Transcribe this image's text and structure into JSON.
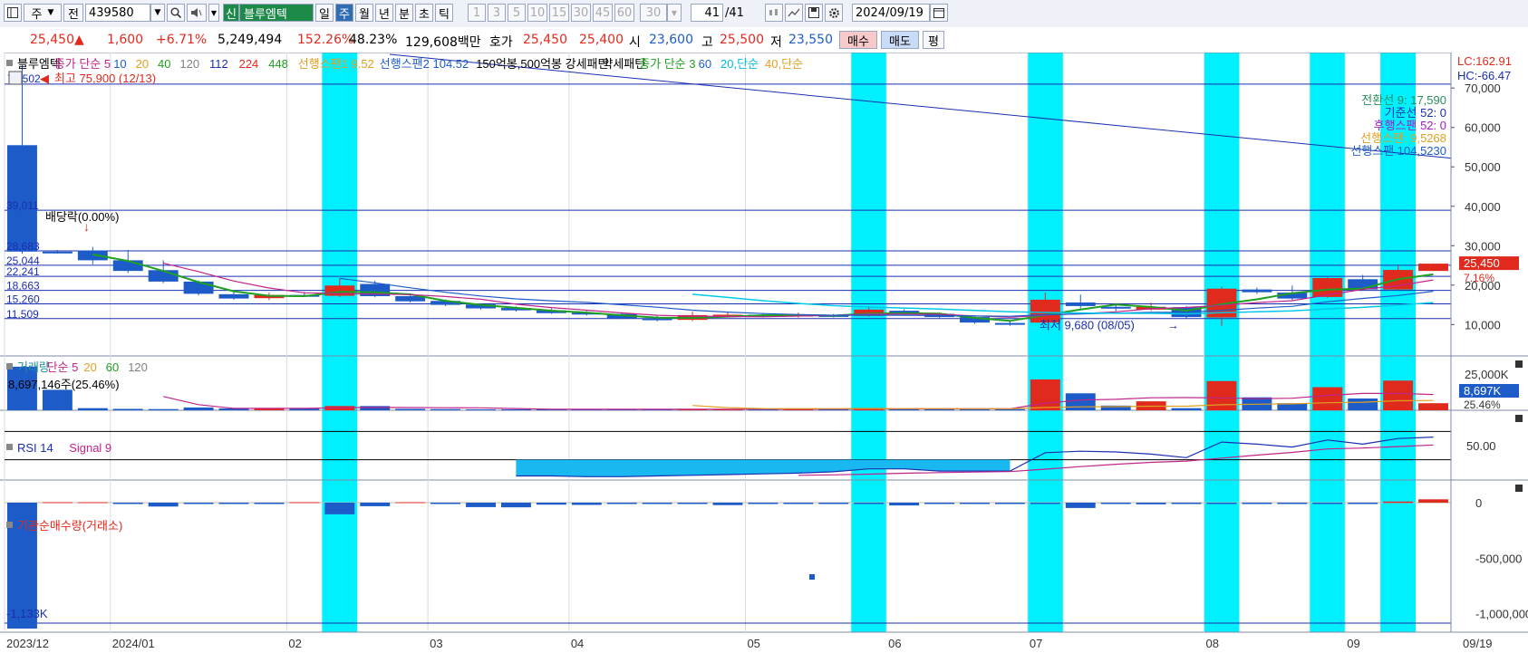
{
  "toolbar": {
    "view_icon": "layout-icon",
    "market_select": "주",
    "prev_label": "전",
    "code": "439580",
    "badge": "신",
    "name": "블루엠텍",
    "period_tabs": [
      "일",
      "주",
      "월",
      "년",
      "분",
      "초",
      "틱"
    ],
    "active_period": "주",
    "intervals": [
      "1",
      "3",
      "5",
      "10",
      "15",
      "30",
      "45",
      "60"
    ],
    "interval_select": "30",
    "count_value": "41",
    "count_total": "/41",
    "date": "2024/09/19"
  },
  "quote": {
    "price": "25,450",
    "change_sign": "▲",
    "change": "1,600",
    "change_pct": "+6.71%",
    "volume": "5,249,494",
    "volume_ratio": "152.26%",
    "turnover_ratio": "48.23%",
    "amount": "129,608백만",
    "hoga_label": "호가",
    "ask": "25,450",
    "bid": "25,400",
    "open_label": "시",
    "open": "23,600",
    "high_label": "고",
    "high": "25,500",
    "low_label": "저",
    "low": "23,550",
    "buy_button": "매수",
    "sell_button": "매도",
    "eval_button": "평"
  },
  "colors": {
    "up": "#e02a1e",
    "down": "#1d5cc8",
    "highlight": "#00f0ff",
    "grid_line": "#1a2fb0",
    "ma5": "#c0248a",
    "ma10": "#1d5cc8",
    "ma20": "#e0a020",
    "ma40": "#20a020"
  },
  "price_pane": {
    "legend": [
      {
        "text": "블루엠텍",
        "color": "#000000"
      },
      {
        "text": "종가 단순 5",
        "color": "#c0248a"
      },
      {
        "text": "10",
        "color": "#1d5cc8"
      },
      {
        "text": "20",
        "color": "#e0a020"
      },
      {
        "text": "40",
        "color": "#20a020"
      },
      {
        "text": "120",
        "color": "#808080"
      },
      {
        "text": "112",
        "color": "#1a2fb0"
      },
      {
        "text": "224",
        "color": "#e02a1e"
      },
      {
        "text": "448",
        "color": "#20a020"
      },
      {
        "text": "선행스팬1 9.52",
        "color": "#e0a020"
      },
      {
        "text": "선행스팬2 104.52",
        "color": "#1d5cc8"
      },
      {
        "text": "150억봉,500억봉 강세패턴",
        "color": "#000000"
      },
      {
        "text": "약세패턴",
        "color": "#000000"
      },
      {
        "text": "종가 단순 3",
        "color": "#20a020"
      },
      {
        "text": "60",
        "color": "#1d5cc8"
      },
      {
        "text": "20,단순",
        "color": "#00c0e0"
      },
      {
        "text": "40,단순",
        "color": "#e0a020"
      }
    ],
    "high_note": "최고 75,900 (12/13)",
    "low_note": "최저 9,680 (08/05)",
    "dividend_note": "배당락(0.00%)",
    "top_left_value": "74,502",
    "level_labels": [
      "39,011",
      "28,683",
      "25,044",
      "22,241",
      "18,663",
      "15,260",
      "11,509"
    ],
    "right_top": [
      "LC:162.91",
      "HC:-66.47"
    ],
    "ichimoku_labels": [
      {
        "text": "전환선 9: 17,590",
        "color": "#2a8f5a"
      },
      {
        "text": "기준선 52: 0",
        "color": "#1a2fb0"
      },
      {
        "text": "후행스팬 52: 0",
        "color": "#a020c0"
      },
      {
        "text": "선행스팬: 9,5268",
        "color": "#e0a020"
      },
      {
        "text": "선행스팬 104,5230",
        "color": "#1d5cc8"
      }
    ],
    "axis": [
      "70,000",
      "60,000",
      "50,000",
      "40,000",
      "30,000",
      "20,000",
      "10,000"
    ],
    "current_price": "25,450",
    "current_pct": "7.16%"
  },
  "volume_pane": {
    "legend": [
      {
        "text": "거래량",
        "color": "#1d8a9a"
      },
      {
        "text": "단순 5",
        "color": "#c0248a"
      },
      {
        "text": "20",
        "color": "#e0a020"
      },
      {
        "text": "60",
        "color": "#20a020"
      },
      {
        "text": "120",
        "color": "#808080"
      }
    ],
    "last_value": "8,697,146주(25.46%)",
    "axis": [
      "25,000K"
    ],
    "current_value": "8,697K",
    "current_pct": "25.46%"
  },
  "rsi_pane": {
    "legend": [
      {
        "text": "RSI 14",
        "color": "#1a2fb0"
      },
      {
        "text": "Signal 9",
        "color": "#c0248a"
      }
    ],
    "axis": [
      "50.00"
    ]
  },
  "inst_pane": {
    "legend": [
      {
        "text": "기관순매수량(거래소)",
        "color": "#e02a1e"
      }
    ],
    "min_label": "-1,133K",
    "axis": [
      "0",
      "-500,000",
      "-1,000,000"
    ]
  },
  "x_axis": [
    "2023/12",
    "2024/01",
    "02",
    "03",
    "04",
    "05",
    "06",
    "07",
    "08",
    "09",
    "09/19"
  ],
  "candles": [
    {
      "o": 55500,
      "c": 28500,
      "h": 75900,
      "l": 28000,
      "up": false
    },
    {
      "o": 28500,
      "c": 28500,
      "h": 28900,
      "l": 28000,
      "up": false
    },
    {
      "o": 28800,
      "c": 26300,
      "h": 29700,
      "l": 25300,
      "up": false
    },
    {
      "o": 26300,
      "c": 23600,
      "h": 28900,
      "l": 23100,
      "up": false
    },
    {
      "o": 23800,
      "c": 20900,
      "h": 26300,
      "l": 20500,
      "up": false
    },
    {
      "o": 20900,
      "c": 17800,
      "h": 21200,
      "l": 17400,
      "up": false
    },
    {
      "o": 17700,
      "c": 16600,
      "h": 18500,
      "l": 16300,
      "up": false
    },
    {
      "o": 16700,
      "c": 17500,
      "h": 18100,
      "l": 16200,
      "up": true
    },
    {
      "o": 17500,
      "c": 17500,
      "h": 18300,
      "l": 17100,
      "up": false
    },
    {
      "o": 17300,
      "c": 19900,
      "h": 21700,
      "l": 17000,
      "up": true
    },
    {
      "o": 20300,
      "c": 17200,
      "h": 21100,
      "l": 16900,
      "up": false
    },
    {
      "o": 17200,
      "c": 15900,
      "h": 17700,
      "l": 15600,
      "up": false
    },
    {
      "o": 16000,
      "c": 15000,
      "h": 16400,
      "l": 14700,
      "up": false
    },
    {
      "o": 15100,
      "c": 14100,
      "h": 15400,
      "l": 13800,
      "up": false
    },
    {
      "o": 14200,
      "c": 13600,
      "h": 14600,
      "l": 13300,
      "up": false
    },
    {
      "o": 13600,
      "c": 12900,
      "h": 14100,
      "l": 12700,
      "up": false
    },
    {
      "o": 13000,
      "c": 12600,
      "h": 13400,
      "l": 12300,
      "up": false
    },
    {
      "o": 12700,
      "c": 11600,
      "h": 13100,
      "l": 11400,
      "up": false
    },
    {
      "o": 11600,
      "c": 11100,
      "h": 12200,
      "l": 10800,
      "up": false
    },
    {
      "o": 11200,
      "c": 12400,
      "h": 13300,
      "l": 10900,
      "up": true
    },
    {
      "o": 12400,
      "c": 12500,
      "h": 13200,
      "l": 12000,
      "up": true
    },
    {
      "o": 12500,
      "c": 12200,
      "h": 12900,
      "l": 11900,
      "up": false
    },
    {
      "o": 12200,
      "c": 12500,
      "h": 13000,
      "l": 11800,
      "up": true
    },
    {
      "o": 12400,
      "c": 12100,
      "h": 12700,
      "l": 11800,
      "up": false
    },
    {
      "o": 12200,
      "c": 13800,
      "h": 14600,
      "l": 12000,
      "up": true
    },
    {
      "o": 13500,
      "c": 12700,
      "h": 13900,
      "l": 12400,
      "up": false
    },
    {
      "o": 12700,
      "c": 11900,
      "h": 13000,
      "l": 11700,
      "up": false
    },
    {
      "o": 11900,
      "c": 10500,
      "h": 12100,
      "l": 10200,
      "up": false
    },
    {
      "o": 10400,
      "c": 10400,
      "h": 10900,
      "l": 9700,
      "up": false
    },
    {
      "o": 10500,
      "c": 16300,
      "h": 18100,
      "l": 10400,
      "up": true
    },
    {
      "o": 15600,
      "c": 14700,
      "h": 17600,
      "l": 14100,
      "up": false
    },
    {
      "o": 14500,
      "c": 14200,
      "h": 15100,
      "l": 13400,
      "up": false
    },
    {
      "o": 13800,
      "c": 14500,
      "h": 15600,
      "l": 13500,
      "up": true
    },
    {
      "o": 14400,
      "c": 11900,
      "h": 14700,
      "l": 11600,
      "up": false
    },
    {
      "o": 11800,
      "c": 19100,
      "h": 19600,
      "l": 9680,
      "up": true
    },
    {
      "o": 18900,
      "c": 18200,
      "h": 19400,
      "l": 17800,
      "up": false
    },
    {
      "o": 18100,
      "c": 16600,
      "h": 19900,
      "l": 16200,
      "up": false
    },
    {
      "o": 17000,
      "c": 21800,
      "h": 22000,
      "l": 16800,
      "up": true
    },
    {
      "o": 21500,
      "c": 18900,
      "h": 22600,
      "l": 18600,
      "up": false
    },
    {
      "o": 18900,
      "c": 23850,
      "h": 25000,
      "l": 18700,
      "up": true
    },
    {
      "o": 23600,
      "c": 25450,
      "h": 25500,
      "l": 23550,
      "up": true
    }
  ],
  "highlight_weeks": [
    9,
    24,
    29,
    34,
    37,
    39
  ],
  "volumes": [
    18.5,
    8.7,
    0.9,
    0.6,
    0.5,
    1.2,
    0.8,
    0.9,
    0.7,
    1.8,
    1.8,
    0.6,
    0.5,
    0.4,
    0.4,
    0.5,
    0.4,
    0.4,
    0.4,
    0.6,
    0.5,
    0.5,
    0.5,
    0.5,
    1.0,
    0.6,
    0.5,
    0.5,
    0.5,
    13.1,
    7.2,
    2.0,
    3.8,
    0.9,
    12.4,
    5.5,
    3.0,
    9.8,
    5.0,
    12.6,
    3.0
  ],
  "rsi": [
    null,
    null,
    null,
    null,
    null,
    null,
    null,
    null,
    null,
    null,
    null,
    null,
    null,
    null,
    7,
    7,
    6,
    6,
    7,
    8,
    9,
    10,
    11,
    13,
    17,
    17,
    14,
    14,
    14,
    40,
    42,
    41,
    38,
    33,
    55,
    52,
    48,
    58,
    52,
    60,
    62
  ],
  "inst_net": [
    -1133,
    0,
    0,
    -6,
    -35,
    -8,
    -6,
    -3,
    0,
    -105,
    -32,
    0,
    -2,
    -40,
    -42,
    -18,
    -20,
    -10,
    -8,
    -12,
    -22,
    -5,
    -3,
    -8,
    -10,
    -25,
    -10,
    -5,
    -6,
    -12,
    -48,
    -12,
    -15,
    -8,
    -6,
    -6,
    -6,
    -5,
    -4,
    10,
    30
  ]
}
